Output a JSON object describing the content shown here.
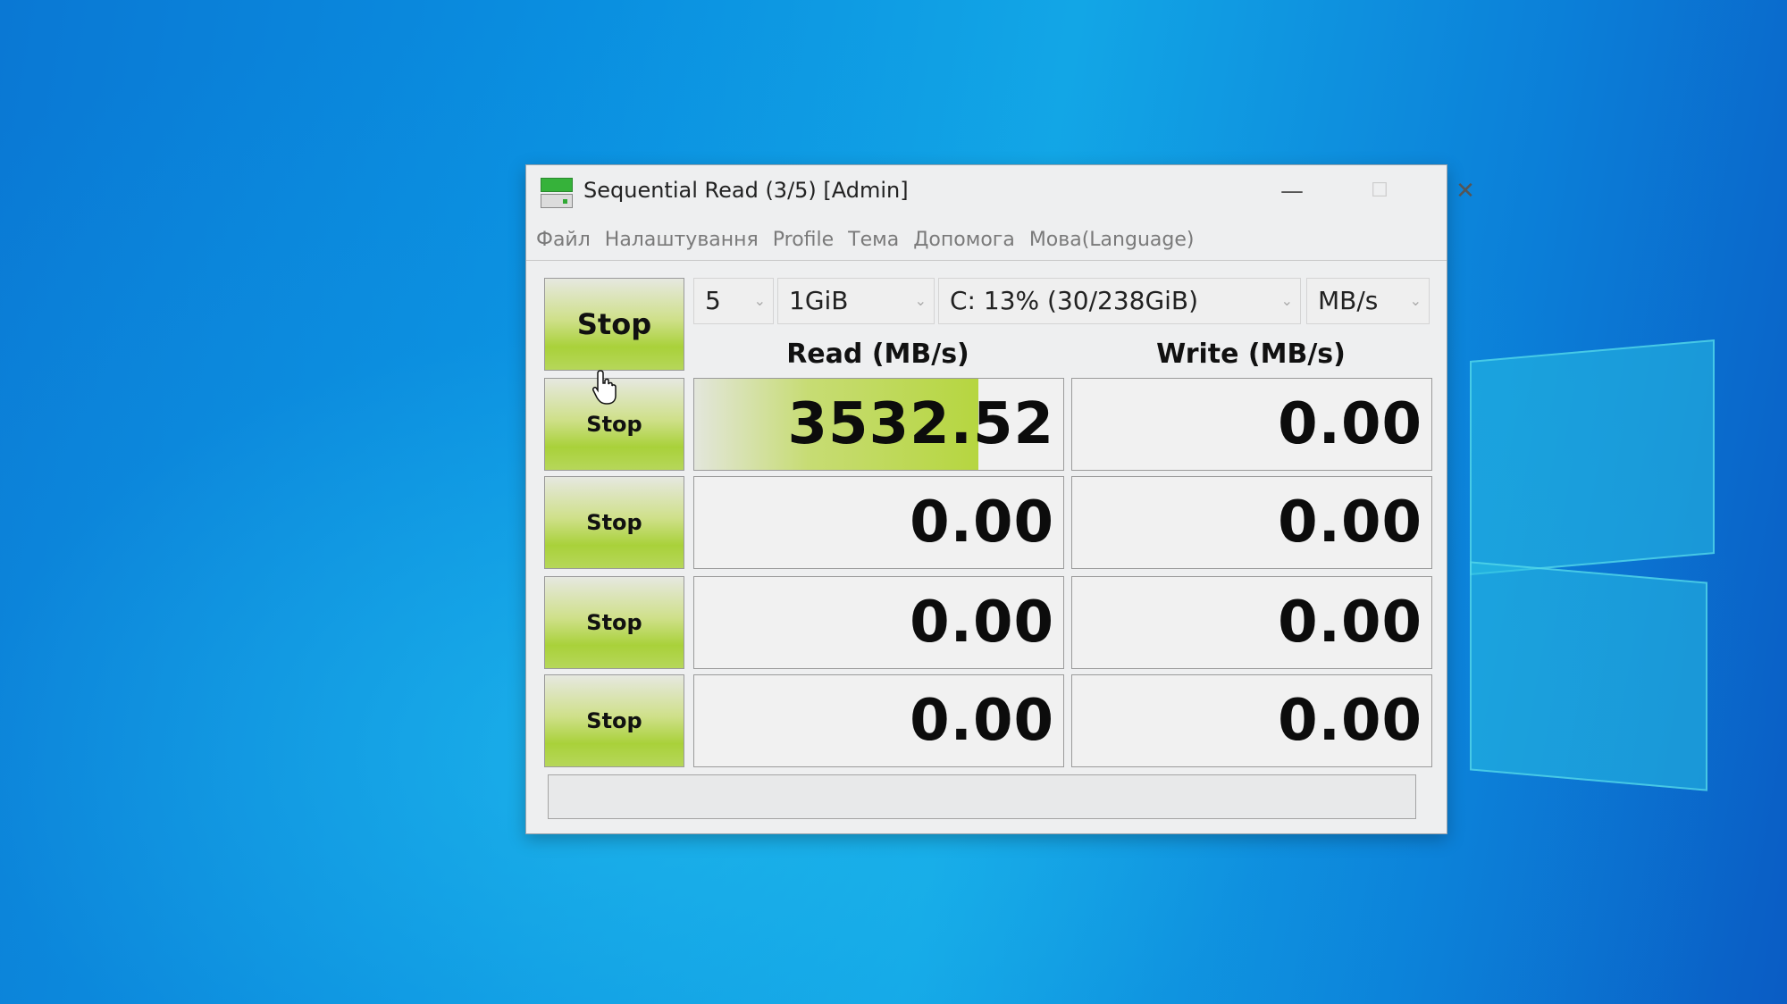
{
  "window": {
    "title": "Sequential Read (3/5) [Admin]",
    "controls": {
      "minimize": "—",
      "maximize": "☐",
      "close": "✕"
    }
  },
  "menu": [
    "Файл",
    "Налаштування",
    "Profile",
    "Тема",
    "Допомога",
    "Мова(Language)"
  ],
  "toolbar": {
    "all_button": "Stop",
    "count": "5",
    "size": "1GiB",
    "drive": "C: 13% (30/238GiB)",
    "unit": "MB/s",
    "chevron": "⌄"
  },
  "columns": {
    "read": "Read (MB/s)",
    "write": "Write (MB/s)"
  },
  "rows": [
    {
      "button": "Stop",
      "read": "3532.52",
      "write": "0.00",
      "read_fill": 0.77,
      "write_fill": 0
    },
    {
      "button": "Stop",
      "read": "0.00",
      "write": "0.00",
      "read_fill": 0,
      "write_fill": 0
    },
    {
      "button": "Stop",
      "read": "0.00",
      "write": "0.00",
      "read_fill": 0,
      "write_fill": 0
    },
    {
      "button": "Stop",
      "read": "0.00",
      "write": "0.00",
      "read_fill": 0,
      "write_fill": 0
    }
  ],
  "status": "",
  "colors": {
    "accent_green": "#a9d13a",
    "desktop_blue": "#0a8fe0"
  }
}
